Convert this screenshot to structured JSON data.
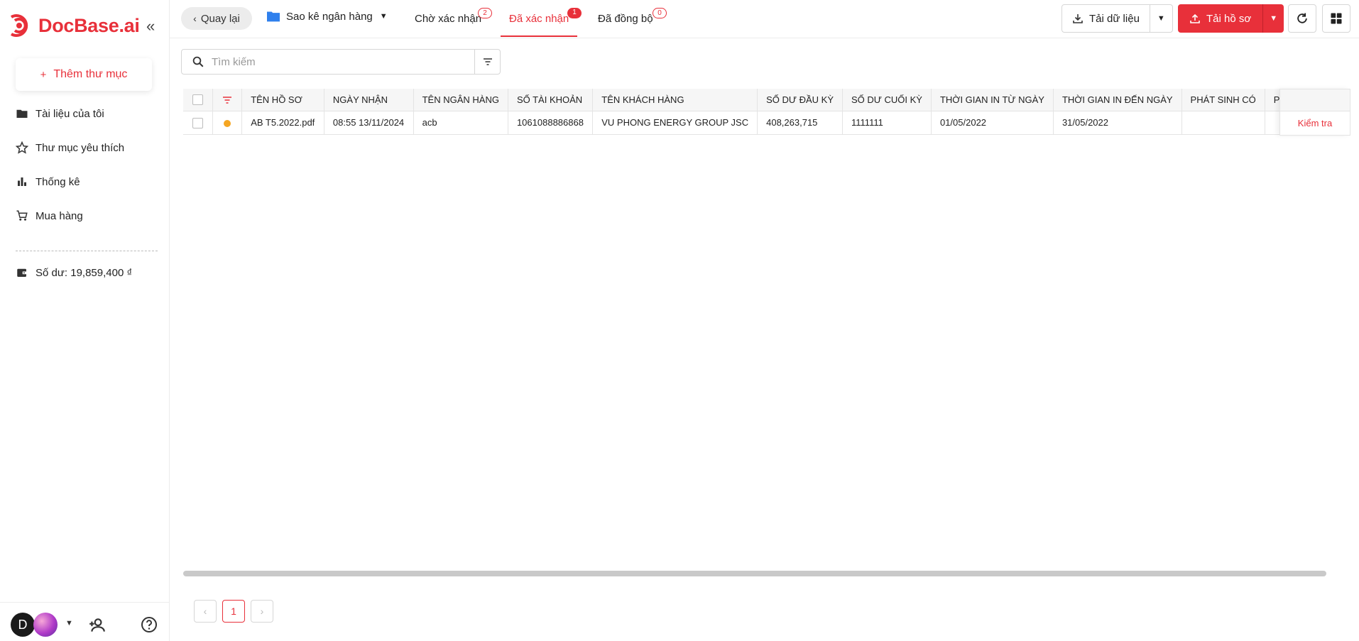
{
  "brand": {
    "name": "DocBase.ai",
    "color": "#e8303a"
  },
  "sidebar": {
    "add_folder_label": "Thêm thư mục",
    "items": [
      {
        "label": "Tài liệu của tôi",
        "icon": "folder-icon"
      },
      {
        "label": "Thư mục yêu thích",
        "icon": "star-icon"
      },
      {
        "label": "Thống kê",
        "icon": "bar-chart-icon"
      },
      {
        "label": "Mua hàng",
        "icon": "cart-icon"
      }
    ],
    "balance_label": "Số dư: 19,859,400 ₫",
    "avatar_initial": "D"
  },
  "toolbar": {
    "back_label": "Quay lại",
    "folder_label": "Sao kê ngân hàng",
    "tabs": [
      {
        "label": "Chờ xác nhận",
        "badge": "2",
        "active": false
      },
      {
        "label": "Đã xác nhận",
        "badge": "1",
        "active": true
      },
      {
        "label": "Đã đồng bộ",
        "badge": "0",
        "active": false
      }
    ],
    "download_data_label": "Tải dữ liệu",
    "upload_label": "Tải hồ sơ"
  },
  "search": {
    "placeholder": "Tìm kiếm"
  },
  "table": {
    "columns": [
      "TÊN HỒ SƠ",
      "NGÀY NHẬN",
      "TÊN NGÂN HÀNG",
      "SỐ TÀI KHOẢN",
      "TÊN KHÁCH HÀNG",
      "SỐ DƯ ĐẦU KỲ",
      "SỐ DƯ CUỐI KỲ",
      "THỜI GIAN IN TỪ NGÀY",
      "THỜI GIAN IN ĐẾN NGÀY",
      "PHÁT SINH CÓ",
      "PHÁT SINH NỢ"
    ],
    "rows": [
      {
        "status_color": "#f5a623",
        "cells": [
          "AB T5.2022.pdf",
          "08:55 13/11/2024",
          "acb",
          "1061088886868",
          "VU PHONG ENERGY GROUP JSC",
          "408,263,715",
          "1111111",
          "01/05/2022",
          "31/05/2022",
          "",
          ""
        ],
        "action_label": "Kiểm tra"
      }
    ]
  },
  "pagination": {
    "current_page": "1"
  }
}
